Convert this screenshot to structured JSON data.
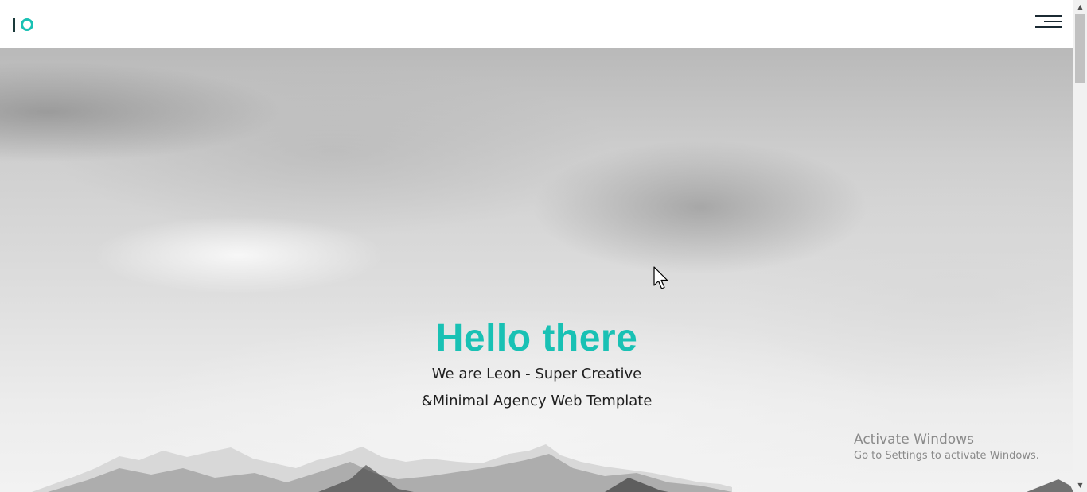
{
  "header": {
    "logo_icon": "leon-logo-icon",
    "menu_icon": "hamburger-menu-icon"
  },
  "hero": {
    "title": "Hello there",
    "subtitle_line1": "We are Leon - Super Creative",
    "subtitle_line2": "&Minimal Agency Web Template"
  },
  "watermark": {
    "title": "Activate Windows",
    "subtitle": "Go to Settings to activate Windows."
  },
  "colors": {
    "accent": "#19c1b4",
    "text_dark": "#1f1f1f",
    "logo_dark": "#1a3a3a"
  }
}
